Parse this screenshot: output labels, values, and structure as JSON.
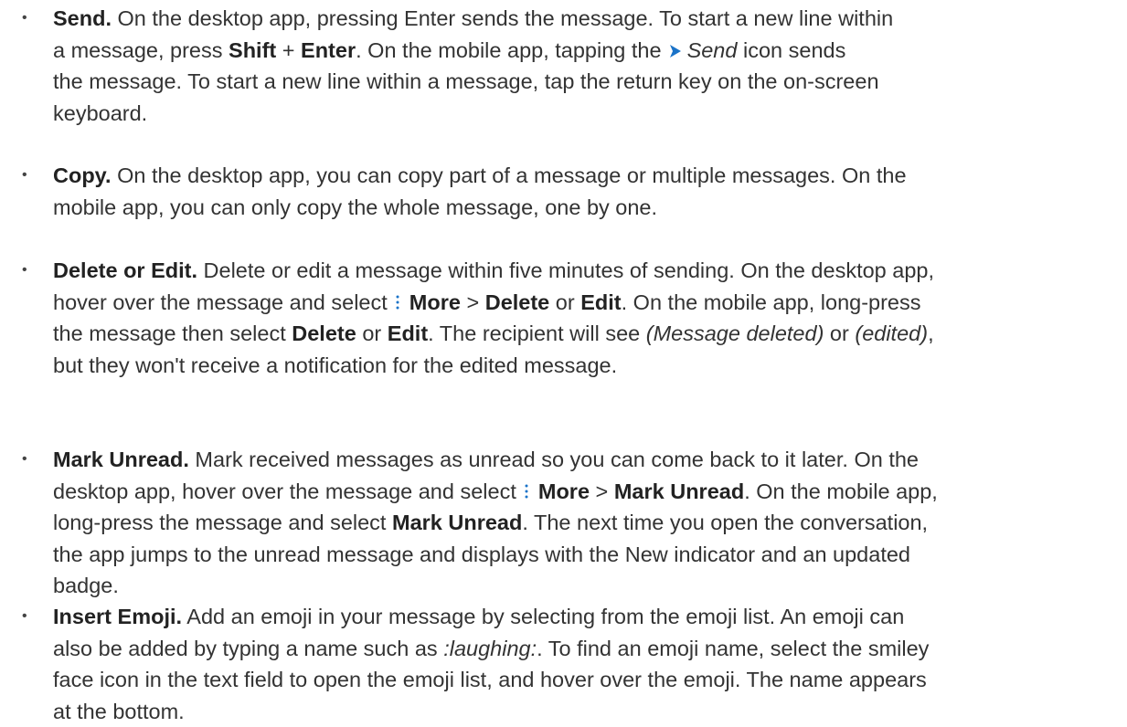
{
  "accent_color": "#1a73c8",
  "bullet_char": "•",
  "items": [
    {
      "lines": [
        [
          {
            "t": "b",
            "v": "Send."
          },
          {
            "t": "n",
            "v": " On the desktop app, pressing Enter sends the message. To start a new line within"
          }
        ],
        [
          {
            "t": "n",
            "v": "a message, press "
          },
          {
            "t": "b",
            "v": "Shift"
          },
          {
            "t": "n",
            "v": " + "
          },
          {
            "t": "b",
            "v": "Enter"
          },
          {
            "t": "n",
            "v": ". On the mobile app, tapping the"
          },
          {
            "t": "icon",
            "v": "send-icon"
          },
          {
            "t": "i",
            "v": "Send"
          },
          {
            "t": "n",
            "v": " icon sends"
          }
        ],
        [
          {
            "t": "n",
            "v": "the message. To start a new line within a message, tap the return key on the on-screen"
          }
        ],
        [
          {
            "t": "n",
            "v": "keyboard."
          }
        ]
      ]
    },
    {
      "lines": [
        [
          {
            "t": "b",
            "v": "Copy."
          },
          {
            "t": "n",
            "v": " On the desktop app, you can copy part of a message or multiple messages. On the"
          }
        ],
        [
          {
            "t": "n",
            "v": "mobile app, you can only copy the whole message, one by one."
          }
        ]
      ]
    },
    {
      "lines": [
        [
          {
            "t": "b",
            "v": "Delete or Edit."
          },
          {
            "t": "n",
            "v": " Delete or edit a message within five minutes of sending. On the desktop app,"
          }
        ],
        [
          {
            "t": "n",
            "v": "hover over the message and select"
          },
          {
            "t": "icon",
            "v": "more-icon"
          },
          {
            "t": "b",
            "v": "More"
          },
          {
            "t": "n",
            "v": " > "
          },
          {
            "t": "b",
            "v": "Delete"
          },
          {
            "t": "n",
            "v": " or "
          },
          {
            "t": "b",
            "v": "Edit"
          },
          {
            "t": "n",
            "v": ". On the mobile app, long-press"
          }
        ],
        [
          {
            "t": "n",
            "v": "the message then select "
          },
          {
            "t": "b",
            "v": "Delete"
          },
          {
            "t": "n",
            "v": " or "
          },
          {
            "t": "b",
            "v": "Edit"
          },
          {
            "t": "n",
            "v": ". The recipient will see "
          },
          {
            "t": "i",
            "v": "(Message deleted)"
          },
          {
            "t": "n",
            "v": " or "
          },
          {
            "t": "i",
            "v": "(edited)"
          },
          {
            "t": "n",
            "v": ","
          }
        ],
        [
          {
            "t": "n",
            "v": "but they won't receive a notification for the edited message."
          }
        ]
      ]
    },
    {
      "lines": [
        [
          {
            "t": "b",
            "v": "Mark Unread."
          },
          {
            "t": "n",
            "v": " Mark received messages as unread so you can come back to it later. On the"
          }
        ],
        [
          {
            "t": "n",
            "v": "desktop app, hover over the message and select"
          },
          {
            "t": "icon",
            "v": "more-icon"
          },
          {
            "t": "b",
            "v": "More"
          },
          {
            "t": "n",
            "v": " > "
          },
          {
            "t": "b",
            "v": "Mark Unread"
          },
          {
            "t": "n",
            "v": ". On the mobile app,"
          }
        ],
        [
          {
            "t": "n",
            "v": "long-press the message and select "
          },
          {
            "t": "b",
            "v": "Mark Unread"
          },
          {
            "t": "n",
            "v": ". The next time you open the conversation,"
          }
        ],
        [
          {
            "t": "n",
            "v": "the app jumps to the unread message and displays with the New indicator and an updated"
          }
        ],
        [
          {
            "t": "n",
            "v": "badge."
          }
        ]
      ]
    },
    {
      "lines": [
        [
          {
            "t": "b",
            "v": "Insert Emoji."
          },
          {
            "t": "n",
            "v": " Add an emoji in your message by selecting from the emoji list. An emoji can"
          }
        ],
        [
          {
            "t": "n",
            "v": "also be added by typing a name such as "
          },
          {
            "t": "i",
            "v": ":laughing:"
          },
          {
            "t": "n",
            "v": ". To find an emoji name, select the smiley"
          }
        ],
        [
          {
            "t": "n",
            "v": "face icon in the text field to open the emoji list, and hover over the emoji. The name appears"
          }
        ],
        [
          {
            "t": "n",
            "v": "at the bottom."
          }
        ]
      ]
    }
  ]
}
